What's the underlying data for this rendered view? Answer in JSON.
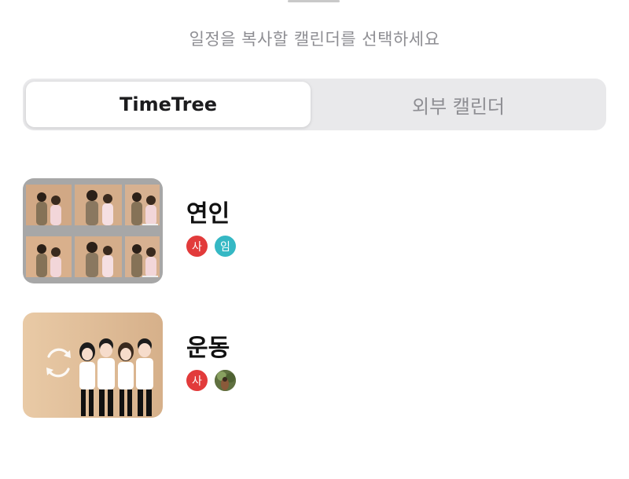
{
  "header": {
    "title": "일정을 복사할 캘린더를 선택하세요"
  },
  "tabs": [
    {
      "label": "TimeTree",
      "selected": true
    },
    {
      "label": "외부 캘린더",
      "selected": false
    }
  ],
  "calendars": [
    {
      "name": "연인",
      "members": [
        {
          "initial": "사",
          "color": "#e23b3b"
        },
        {
          "initial": "임",
          "color": "#35b8c4"
        }
      ]
    },
    {
      "name": "운동",
      "members": [
        {
          "initial": "사",
          "color": "#e23b3b"
        },
        {
          "initial": "",
          "color": "#6b7a45",
          "is_photo": true
        }
      ]
    }
  ]
}
